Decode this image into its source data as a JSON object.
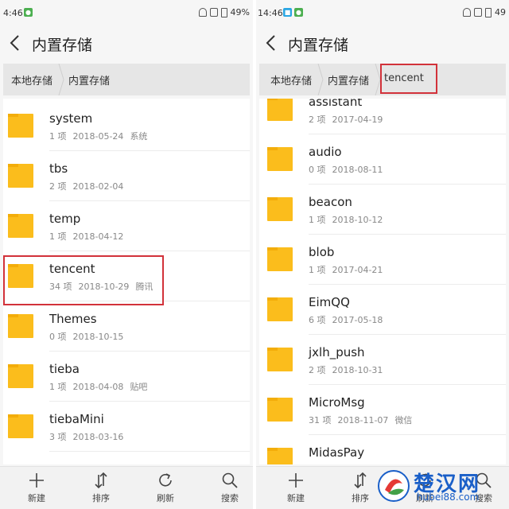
{
  "left": {
    "status": {
      "time": "4:46",
      "battery": "49%"
    },
    "title": "内置存储",
    "breadcrumbs": [
      "本地存储",
      "内置存储"
    ],
    "folders": [
      {
        "name": "system",
        "count": "1 项",
        "date": "2018-05-24",
        "tag": "系统"
      },
      {
        "name": "tbs",
        "count": "2 项",
        "date": "2018-02-04",
        "tag": ""
      },
      {
        "name": "temp",
        "count": "1 项",
        "date": "2018-04-12",
        "tag": ""
      },
      {
        "name": "tencent",
        "count": "34 项",
        "date": "2018-10-29",
        "tag": "腾讯"
      },
      {
        "name": "Themes",
        "count": "0 项",
        "date": "2018-10-15",
        "tag": ""
      },
      {
        "name": "tieba",
        "count": "1 项",
        "date": "2018-04-08",
        "tag": "贴吧"
      },
      {
        "name": "tiebaMini",
        "count": "3 项",
        "date": "2018-03-16",
        "tag": ""
      }
    ],
    "actions": [
      "新建",
      "排序",
      "刷新",
      "搜索"
    ]
  },
  "right": {
    "status": {
      "time": "14:46",
      "battery": "49"
    },
    "title": "内置存储",
    "breadcrumbs": [
      "本地存储",
      "内置存储",
      "tencent"
    ],
    "folders": [
      {
        "name": "assistant",
        "count": "2 项",
        "date": "2017-04-19",
        "tag": ""
      },
      {
        "name": "audio",
        "count": "0 项",
        "date": "2018-08-11",
        "tag": ""
      },
      {
        "name": "beacon",
        "count": "1 项",
        "date": "2018-10-12",
        "tag": ""
      },
      {
        "name": "blob",
        "count": "1 项",
        "date": "2017-04-21",
        "tag": ""
      },
      {
        "name": "EimQQ",
        "count": "6 项",
        "date": "2017-05-18",
        "tag": ""
      },
      {
        "name": "jxlh_push",
        "count": "2 项",
        "date": "2018-10-31",
        "tag": ""
      },
      {
        "name": "MicroMsg",
        "count": "31 项",
        "date": "2018-11-07",
        "tag": "微信"
      },
      {
        "name": "MidasPay",
        "count": "",
        "date": "",
        "tag": ""
      }
    ],
    "actions": [
      "新建",
      "排序",
      "刷新",
      "搜索"
    ]
  },
  "watermark": {
    "title": "楚汉网",
    "url": "hubei88.com"
  },
  "colors": {
    "folder": "#fbbd1c",
    "highlight": "#d2323a",
    "watermark": "#1a5fc8"
  },
  "icons": [
    "back-arrow-icon",
    "folder-icon",
    "plus-icon",
    "sort-icon",
    "refresh-icon",
    "search-icon"
  ]
}
